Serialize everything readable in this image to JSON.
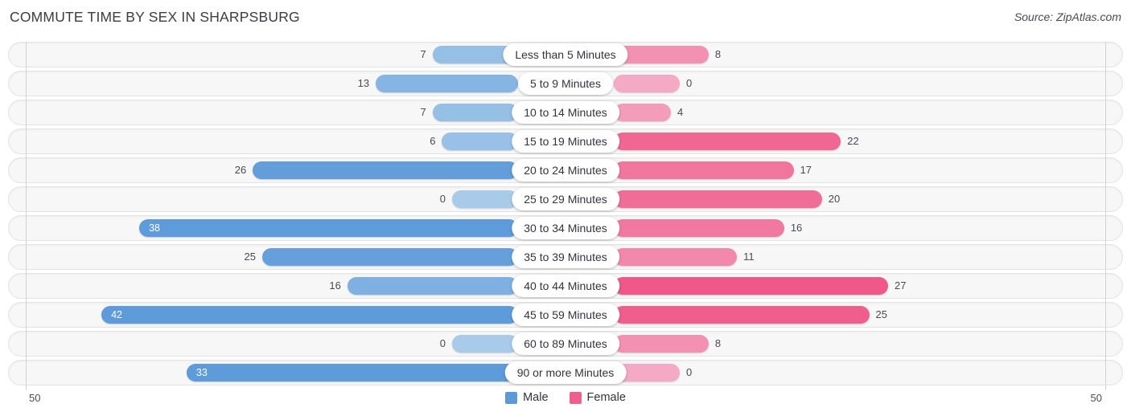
{
  "header": {
    "title": "COMMUTE TIME BY SEX IN SHARPSBURG",
    "source": "Source: ZipAtlas.com"
  },
  "axis": {
    "left_label": "50",
    "right_label": "50"
  },
  "legend": {
    "items": [
      {
        "label": "Male",
        "color": "#5b9bd5"
      },
      {
        "label": "Female",
        "color": "#ee5f8e"
      }
    ]
  },
  "chart_data": {
    "type": "bar",
    "subtype": "diverging-bidirectional",
    "title": "COMMUTE TIME BY SEX IN SHARPSBURG",
    "xlabel": "",
    "ylabel": "",
    "xlim": [
      -50,
      50
    ],
    "axis_max_per_side": 50,
    "grid": false,
    "legend_position": "bottom-center",
    "categories": [
      "Less than 5 Minutes",
      "5 to 9 Minutes",
      "10 to 14 Minutes",
      "15 to 19 Minutes",
      "20 to 24 Minutes",
      "25 to 29 Minutes",
      "30 to 34 Minutes",
      "35 to 39 Minutes",
      "40 to 44 Minutes",
      "45 to 59 Minutes",
      "60 to 89 Minutes",
      "90 or more Minutes"
    ],
    "series": [
      {
        "name": "Male",
        "direction": "left",
        "color": "#5b9bd5",
        "values": [
          7,
          13,
          7,
          6,
          26,
          0,
          38,
          25,
          16,
          42,
          0,
          33
        ]
      },
      {
        "name": "Female",
        "direction": "right",
        "color": "#ee5f8e",
        "values": [
          8,
          0,
          4,
          22,
          17,
          20,
          16,
          11,
          27,
          25,
          8,
          0
        ]
      }
    ],
    "rows": [
      {
        "category": "Less than 5 Minutes",
        "male": 7,
        "female": 8,
        "male_text": "7",
        "female_text": "8"
      },
      {
        "category": "5 to 9 Minutes",
        "male": 13,
        "female": 0,
        "male_text": "13",
        "female_text": "0"
      },
      {
        "category": "10 to 14 Minutes",
        "male": 7,
        "female": 4,
        "male_text": "7",
        "female_text": "4"
      },
      {
        "category": "15 to 19 Minutes",
        "male": 6,
        "female": 22,
        "male_text": "6",
        "female_text": "22"
      },
      {
        "category": "20 to 24 Minutes",
        "male": 26,
        "female": 17,
        "male_text": "26",
        "female_text": "17"
      },
      {
        "category": "25 to 29 Minutes",
        "male": 0,
        "female": 20,
        "male_text": "0",
        "female_text": "20"
      },
      {
        "category": "30 to 34 Minutes",
        "male": 38,
        "female": 16,
        "male_text": "38",
        "female_text": "16"
      },
      {
        "category": "35 to 39 Minutes",
        "male": 25,
        "female": 11,
        "male_text": "25",
        "female_text": "11"
      },
      {
        "category": "40 to 44 Minutes",
        "male": 16,
        "female": 27,
        "male_text": "16",
        "female_text": "27"
      },
      {
        "category": "45 to 59 Minutes",
        "male": 42,
        "female": 25,
        "male_text": "42",
        "female_text": "25"
      },
      {
        "category": "60 to 89 Minutes",
        "male": 0,
        "female": 8,
        "male_text": "0",
        "female_text": "8"
      },
      {
        "category": "90 or more Minutes",
        "male": 33,
        "female": 0,
        "male_text": "33",
        "female_text": "0"
      }
    ]
  }
}
